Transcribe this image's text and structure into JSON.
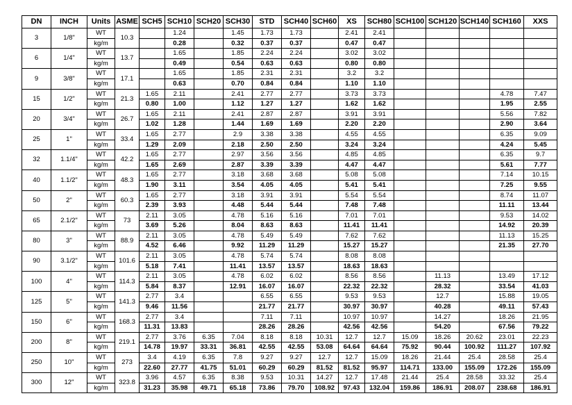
{
  "headers": [
    "DN",
    "INCH",
    "Units",
    "ASME",
    "SCH5",
    "SCH10",
    "SCH20",
    "SCH30",
    "STD",
    "SCH40",
    "SCH60",
    "XS",
    "SCH80",
    "SCH100",
    "SCH120",
    "SCH140",
    "SCH160",
    "XXS"
  ],
  "units": {
    "wt": "WT",
    "kg": "kg/m"
  },
  "rows": [
    {
      "dn": "3",
      "inch": "1/8\"",
      "asme": "10.3",
      "wt": [
        "",
        "1.24",
        "",
        "1.45",
        "1.73",
        "1.73",
        "",
        "2.41",
        "2.41",
        "",
        "",
        "",
        "",
        ""
      ],
      "kg": [
        "",
        "0.28",
        "",
        "0.32",
        "0.37",
        "0.37",
        "",
        "0.47",
        "0.47",
        "",
        "",
        "",
        "",
        ""
      ]
    },
    {
      "dn": "6",
      "inch": "1/4\"",
      "asme": "13.7",
      "wt": [
        "",
        "1.65",
        "",
        "1.85",
        "2.24",
        "2.24",
        "",
        "3.02",
        "3.02",
        "",
        "",
        "",
        "",
        ""
      ],
      "kg": [
        "",
        "0.49",
        "",
        "0.54",
        "0.63",
        "0.63",
        "",
        "0.80",
        "0.80",
        "",
        "",
        "",
        "",
        ""
      ]
    },
    {
      "dn": "9",
      "inch": "3/8\"",
      "asme": "17.1",
      "wt": [
        "",
        "1.65",
        "",
        "1.85",
        "2.31",
        "2.31",
        "",
        "3.2",
        "3.2",
        "",
        "",
        "",
        "",
        ""
      ],
      "kg": [
        "",
        "0.63",
        "",
        "0.70",
        "0.84",
        "0.84",
        "",
        "1.10",
        "1.10",
        "",
        "",
        "",
        "",
        ""
      ]
    },
    {
      "dn": "15",
      "inch": "1/2\"",
      "asme": "21.3",
      "wt": [
        "1.65",
        "2.11",
        "",
        "2.41",
        "2.77",
        "2.77",
        "",
        "3.73",
        "3.73",
        "",
        "",
        "",
        "4.78",
        "7.47"
      ],
      "kg": [
        "0.80",
        "1.00",
        "",
        "1.12",
        "1.27",
        "1.27",
        "",
        "1.62",
        "1.62",
        "",
        "",
        "",
        "1.95",
        "2.55"
      ]
    },
    {
      "dn": "20",
      "inch": "3/4\"",
      "asme": "26.7",
      "wt": [
        "1.65",
        "2.11",
        "",
        "2.41",
        "2.87",
        "2.87",
        "",
        "3.91",
        "3.91",
        "",
        "",
        "",
        "5.56",
        "7.82"
      ],
      "kg": [
        "1.02",
        "1.28",
        "",
        "1.44",
        "1.69",
        "1.69",
        "",
        "2.20",
        "2.20",
        "",
        "",
        "",
        "2.90",
        "3.64"
      ]
    },
    {
      "dn": "25",
      "inch": "1\"",
      "asme": "33.4",
      "wt": [
        "1.65",
        "2.77",
        "",
        "2.9",
        "3.38",
        "3.38",
        "",
        "4.55",
        "4.55",
        "",
        "",
        "",
        "6.35",
        "9.09"
      ],
      "kg": [
        "1.29",
        "2.09",
        "",
        "2.18",
        "2.50",
        "2.50",
        "",
        "3.24",
        "3.24",
        "",
        "",
        "",
        "4.24",
        "5.45"
      ]
    },
    {
      "dn": "32",
      "inch": "1.1/4\"",
      "asme": "42.2",
      "wt": [
        "1.65",
        "2.77",
        "",
        "2.97",
        "3.56",
        "3.56",
        "",
        "4.85",
        "4.85",
        "",
        "",
        "",
        "6.35",
        "9.7"
      ],
      "kg": [
        "1.65",
        "2.69",
        "",
        "2.87",
        "3.39",
        "3.39",
        "",
        "4.47",
        "4.47",
        "",
        "",
        "",
        "5.61",
        "7.77"
      ]
    },
    {
      "dn": "40",
      "inch": "1.1/2\"",
      "asme": "48.3",
      "wt": [
        "1.65",
        "2.77",
        "",
        "3.18",
        "3.68",
        "3.68",
        "",
        "5.08",
        "5.08",
        "",
        "",
        "",
        "7.14",
        "10.15"
      ],
      "kg": [
        "1.90",
        "3.11",
        "",
        "3.54",
        "4.05",
        "4.05",
        "",
        "5.41",
        "5.41",
        "",
        "",
        "",
        "7.25",
        "9.55"
      ]
    },
    {
      "dn": "50",
      "inch": "2\"",
      "asme": "60.3",
      "wt": [
        "1.65",
        "2.77",
        "",
        "3.18",
        "3.91",
        "3.91",
        "",
        "5.54",
        "5.54",
        "",
        "",
        "",
        "8.74",
        "11.07"
      ],
      "kg": [
        "2.39",
        "3.93",
        "",
        "4.48",
        "5.44",
        "5.44",
        "",
        "7.48",
        "7.48",
        "",
        "",
        "",
        "11.11",
        "13.44"
      ]
    },
    {
      "dn": "65",
      "inch": "2.1/2\"",
      "asme": "73",
      "wt": [
        "2.11",
        "3.05",
        "",
        "4.78",
        "5.16",
        "5.16",
        "",
        "7.01",
        "7.01",
        "",
        "",
        "",
        "9.53",
        "14.02"
      ],
      "kg": [
        "3.69",
        "5.26",
        "",
        "8.04",
        "8.63",
        "8.63",
        "",
        "11.41",
        "11.41",
        "",
        "",
        "",
        "14.92",
        "20.39"
      ]
    },
    {
      "dn": "80",
      "inch": "3\"",
      "asme": "88.9",
      "wt": [
        "2.11",
        "3.05",
        "",
        "4.78",
        "5.49",
        "5.49",
        "",
        "7.62",
        "7.62",
        "",
        "",
        "",
        "11.13",
        "15.25"
      ],
      "kg": [
        "4.52",
        "6.46",
        "",
        "9.92",
        "11.29",
        "11.29",
        "",
        "15.27",
        "15.27",
        "",
        "",
        "",
        "21.35",
        "27.70"
      ]
    },
    {
      "dn": "90",
      "inch": "3.1/2\"",
      "asme": "101.6",
      "wt": [
        "2.11",
        "3.05",
        "",
        "4.78",
        "5.74",
        "5.74",
        "",
        "8.08",
        "8.08",
        "",
        "",
        "",
        "",
        ""
      ],
      "kg": [
        "5.18",
        "7.41",
        "",
        "11.41",
        "13.57",
        "13.57",
        "",
        "18.63",
        "18.63",
        "",
        "",
        "",
        "",
        ""
      ]
    },
    {
      "dn": "100",
      "inch": "4\"",
      "asme": "114.3",
      "wt": [
        "2.11",
        "3.05",
        "",
        "4.78",
        "6.02",
        "6.02",
        "",
        "8.56",
        "8.56",
        "",
        "11.13",
        "",
        "13.49",
        "17.12"
      ],
      "kg": [
        "5.84",
        "8.37",
        "",
        "12.91",
        "16.07",
        "16.07",
        "",
        "22.32",
        "22.32",
        "",
        "28.32",
        "",
        "33.54",
        "41.03"
      ]
    },
    {
      "dn": "125",
      "inch": "5\"",
      "asme": "141.3",
      "wt": [
        "2.77",
        "3.4",
        "",
        "",
        "6.55",
        "6.55",
        "",
        "9.53",
        "9.53",
        "",
        "12.7",
        "",
        "15.88",
        "19.05"
      ],
      "kg": [
        "9.46",
        "11.56",
        "",
        "",
        "21.77",
        "21.77",
        "",
        "30.97",
        "30.97",
        "",
        "40.28",
        "",
        "49.11",
        "57.43"
      ]
    },
    {
      "dn": "150",
      "inch": "6\"",
      "asme": "168.3",
      "wt": [
        "2.77",
        "3.4",
        "",
        "",
        "7.11",
        "7.11",
        "",
        "10.97",
        "10.97",
        "",
        "14.27",
        "",
        "18.26",
        "21.95"
      ],
      "kg": [
        "11.31",
        "13.83",
        "",
        "",
        "28.26",
        "28.26",
        "",
        "42.56",
        "42.56",
        "",
        "54.20",
        "",
        "67.56",
        "79.22"
      ]
    },
    {
      "dn": "200",
      "inch": "8\"",
      "asme": "219.1",
      "wt": [
        "2.77",
        "3.76",
        "6.35",
        "7.04",
        "8.18",
        "8.18",
        "10.31",
        "12.7",
        "12.7",
        "15.09",
        "18.26",
        "20.62",
        "23.01",
        "22.23"
      ],
      "kg": [
        "14.78",
        "19.97",
        "33.31",
        "36.81",
        "42.55",
        "42.55",
        "53.08",
        "64.64",
        "64.64",
        "75.92",
        "90.44",
        "100.92",
        "111.27",
        "107.92"
      ]
    },
    {
      "dn": "250",
      "inch": "10\"",
      "asme": "273",
      "wt": [
        "3.4",
        "4.19",
        "6.35",
        "7.8",
        "9.27",
        "9.27",
        "12.7",
        "12.7",
        "15.09",
        "18.26",
        "21.44",
        "25.4",
        "28.58",
        "25.4"
      ],
      "kg": [
        "22.60",
        "27.77",
        "41.75",
        "51.01",
        "60.29",
        "60.29",
        "81.52",
        "81.52",
        "95.97",
        "114.71",
        "133.00",
        "155.09",
        "172.26",
        "155.09"
      ]
    },
    {
      "dn": "300",
      "inch": "12\"",
      "asme": "323.8",
      "wt": [
        "3.96",
        "4.57",
        "6.35",
        "8.38",
        "9.53",
        "10.31",
        "14.27",
        "12.7",
        "17.48",
        "21.44",
        "25.4",
        "28.58",
        "33.32",
        "25.4"
      ],
      "kg": [
        "31.23",
        "35.98",
        "49.71",
        "65.18",
        "73.86",
        "79.70",
        "108.92",
        "97.43",
        "132.04",
        "159.86",
        "186.91",
        "208.07",
        "238.68",
        "186.91"
      ]
    }
  ]
}
